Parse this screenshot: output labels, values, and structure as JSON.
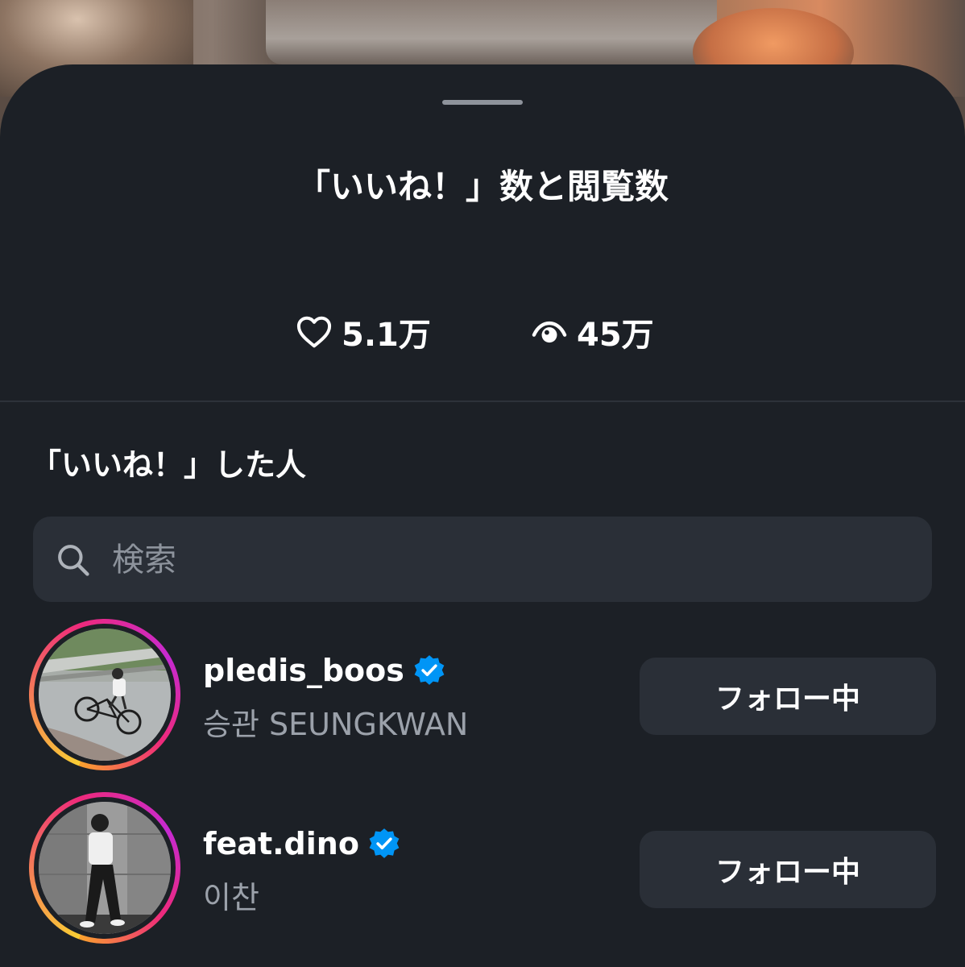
{
  "sheet": {
    "title": "「いいね！」数と閲覧数"
  },
  "stats": {
    "likes_icon": "heart-outline-icon",
    "likes": "5.1万",
    "views_icon": "eye-icon",
    "views": "45万"
  },
  "likers_section": {
    "title": "「いいね！」した人"
  },
  "search": {
    "icon": "search-icon",
    "placeholder": "検索"
  },
  "users": [
    {
      "username": "pledis_boos",
      "verified": true,
      "full_name": "승관 SEUNGKWAN",
      "follow_label": "フォロー中",
      "avatar": "photo-boy-on-bicycle"
    },
    {
      "username": "feat.dino",
      "verified": true,
      "full_name": "이찬",
      "follow_label": "フォロー中",
      "avatar": "photo-bw-person-leaning-on-wall"
    }
  ],
  "colors": {
    "sheet_bg": "#1c2026",
    "input_bg": "#2a2f37",
    "verified_blue": "#0095f6",
    "secondary_text": "#9ba1aa"
  }
}
